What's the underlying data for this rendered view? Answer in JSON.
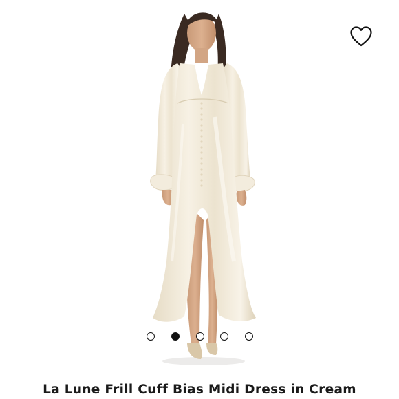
{
  "product": {
    "title": "La Lune Frill Cuff Bias Midi Dress in Cream",
    "image_subject": "model wearing a cream satin long-sleeve midi dress with front slit"
  },
  "icons": {
    "wishlist": "heart-outline-icon"
  },
  "carousel": {
    "total": 5,
    "active_index": 1
  },
  "colors": {
    "text": "#1a1a1a",
    "dress": "#efe7d6",
    "background": "#ffffff"
  }
}
